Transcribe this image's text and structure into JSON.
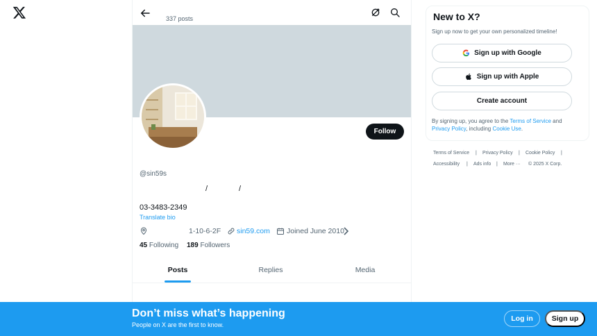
{
  "brand": {
    "logo_icon": "x-logo-icon",
    "accent": "#1d9bf0"
  },
  "header": {
    "post_count": "337 posts"
  },
  "profile": {
    "handle": "@sin59s",
    "bio_slash_1": "/",
    "bio_slash_2": "/",
    "phone": "03-3483-2349",
    "translate": "Translate bio",
    "location": "1-10-6-2F",
    "website": "sin59.com",
    "joined": "Joined June 2010",
    "following_count": "45",
    "following_label": "Following",
    "followers_count": "189",
    "followers_label": "Followers",
    "follow_button": "Follow"
  },
  "tabs": {
    "posts": "Posts",
    "replies": "Replies",
    "media": "Media"
  },
  "signup_card": {
    "title": "New to X?",
    "subtitle": "Sign up now to get your own personalized timeline!",
    "google": "Sign up with Google",
    "apple": "Sign up with Apple",
    "create": "Create account",
    "disclaimer_1": "By signing up, you agree to the ",
    "terms": "Terms of Service",
    "disclaimer_2": " and ",
    "privacy": "Privacy Policy",
    "disclaimer_3": ", including ",
    "cookie": "Cookie Use",
    "disclaimer_4": "."
  },
  "footer": {
    "terms": "Terms of Service",
    "privacy": "Privacy Policy",
    "cookie": "Cookie Policy",
    "accessibility": "Accessibility",
    "ads": "Ads info",
    "more": "More ···",
    "copyright": "© 2025 X Corp.",
    "sep": "|"
  },
  "bottom_bar": {
    "title": "Don’t miss what’s happening",
    "subtitle": "People on X are the first to know.",
    "login": "Log in",
    "signup": "Sign up"
  }
}
